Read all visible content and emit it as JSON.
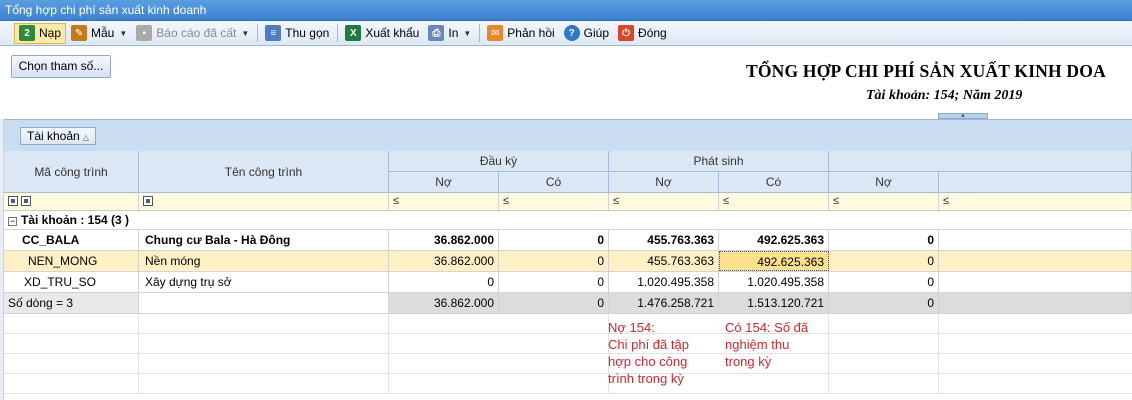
{
  "window": {
    "title": "Tổng hợp chi phí sản xuất kinh doanh"
  },
  "toolbar": {
    "items": [
      {
        "label": "Nạp",
        "icon": "refresh-icon",
        "color": "#2c8a3a"
      },
      {
        "label": "Mẫu",
        "icon": "template-icon",
        "color": "#c77a1a"
      },
      {
        "label": "Báo cáo đã cất",
        "icon": "save-icon",
        "color": "#9a9a9a"
      },
      {
        "label": "Thu gọn",
        "icon": "collapse-icon",
        "color": "#4b7fbf"
      },
      {
        "label": "Xuất khẩu",
        "icon": "excel-icon",
        "color": "#1e7a3e"
      },
      {
        "label": "In",
        "icon": "print-icon",
        "color": "#6b86b8"
      },
      {
        "label": "Phản hồi",
        "icon": "mail-icon",
        "color": "#e58a26"
      },
      {
        "label": "Giúp",
        "icon": "help-icon",
        "color": "#2f77c9"
      },
      {
        "label": "Đóng",
        "icon": "close-icon",
        "color": "#d8452a"
      }
    ]
  },
  "params": {
    "button_label": "Chọn tham số...",
    "report_title": "TỔNG HỢP CHI PHÍ SẢN XUẤT KINH DOA",
    "report_subtitle": "Tài khoản: 154; Năm 2019"
  },
  "group_panel": {
    "chip_label": "Tài khoản"
  },
  "grid": {
    "headers": {
      "ma_cong_trinh": "Mã công trình",
      "ten_cong_trinh": "Tên công trình",
      "dau_ky": "Đầu kỳ",
      "phat_sinh": "Phát sinh",
      "no": "Nợ",
      "co": "Có"
    },
    "filter_op": "≤",
    "group_row": "Tài khoản : 154 (3 )",
    "rows": [
      {
        "ma": "CC_BALA",
        "ten": "Chung cư Bala - Hà Đông",
        "dk_no": "36.862.000",
        "dk_co": "0",
        "ps_no": "455.763.363",
        "ps_co": "492.625.363",
        "ck_no": "0"
      },
      {
        "ma": "NEN_MONG",
        "ten": "Nền móng",
        "dk_no": "36.862.000",
        "dk_co": "0",
        "ps_no": "455.763.363",
        "ps_co": "492.625.363",
        "ck_no": "0"
      },
      {
        "ma": "XD_TRU_SO",
        "ten": "Xây dựng trụ sở",
        "dk_no": "0",
        "dk_co": "0",
        "ps_no": "1.020.495.358",
        "ps_co": "1.020.495.358",
        "ck_no": "0"
      }
    ],
    "total": {
      "label": "Số dòng = 3",
      "dk_no": "36.862.000",
      "dk_co": "0",
      "ps_no": "1.476.258.721",
      "ps_co": "1.513.120.721",
      "ck_no": "0"
    }
  },
  "annotations": {
    "note1": "Nợ 154:\nChi phí đã tập\nhợp cho công\ntrình trong kỳ",
    "note2": "Có 154: Số đã\nnghiệm thu\ntrong kỳ"
  }
}
